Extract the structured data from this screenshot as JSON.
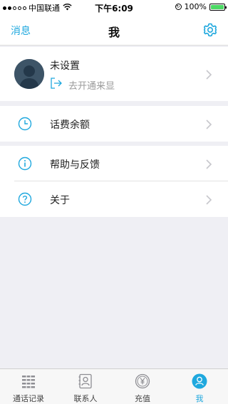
{
  "status_bar": {
    "carrier": "中国联通",
    "time": "下午6:09",
    "battery_percent": "100%",
    "battery_level": 1.0
  },
  "nav": {
    "left_label": "消息",
    "title": "我",
    "right_icon": "gear-icon"
  },
  "profile": {
    "name": "未设置",
    "sub_label": "去开通来显"
  },
  "menu": {
    "balance": "话费余额",
    "help": "帮助与反馈",
    "about": "关于"
  },
  "tabs": [
    {
      "label": "通话记录",
      "icon": "dialpad-icon",
      "active": false
    },
    {
      "label": "联系人",
      "icon": "contacts-icon",
      "active": false
    },
    {
      "label": "充值",
      "icon": "yen-icon",
      "active": false
    },
    {
      "label": "我",
      "icon": "person-icon",
      "active": true
    }
  ],
  "colors": {
    "accent": "#1fa8de",
    "background": "#efeff4",
    "battery": "#4cd964"
  }
}
